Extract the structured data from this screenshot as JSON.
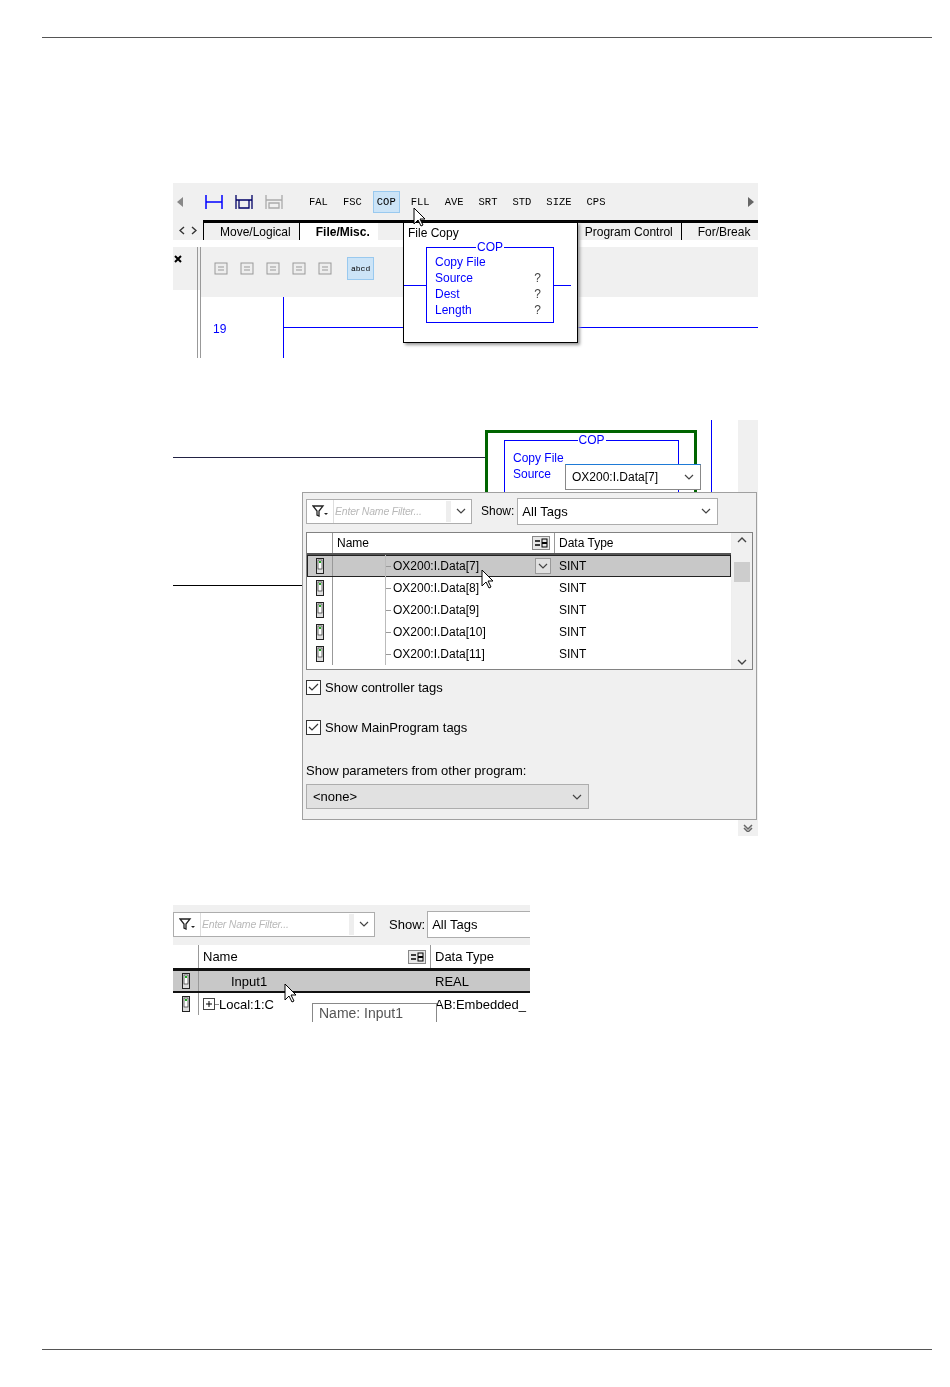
{
  "figure_1": {
    "instruction_buttons": [
      {
        "label": "FAL",
        "selected": false
      },
      {
        "label": "FSC",
        "selected": false
      },
      {
        "label": "COP",
        "selected": true
      },
      {
        "label": "FLL",
        "selected": false
      },
      {
        "label": "AVE",
        "selected": false
      },
      {
        "label": "SRT",
        "selected": false
      },
      {
        "label": "STD",
        "selected": false
      },
      {
        "label": "SIZE",
        "selected": false
      },
      {
        "label": "CPS",
        "selected": false
      }
    ],
    "category_tabs": [
      {
        "label": "Move/Logical",
        "selected": false
      },
      {
        "label": "File/Misc.",
        "selected": true
      },
      {
        "label": "Program Control",
        "selected": false
      },
      {
        "label": "For/Break",
        "selected": false
      }
    ],
    "element_buttons": [
      {
        "label": "abcd",
        "selected": true
      }
    ],
    "rung_number": "19",
    "tooltip": {
      "title": "File Copy",
      "block": {
        "mnemonic": "COP",
        "title": "Copy File",
        "operands": [
          {
            "name": "Source",
            "value": "?"
          },
          {
            "name": "Dest",
            "value": "?"
          },
          {
            "name": "Length",
            "value": "?"
          }
        ]
      }
    }
  },
  "figure_2": {
    "block": {
      "mnemonic": "COP",
      "title": "Copy File",
      "operands": [
        {
          "name": "Source"
        }
      ]
    },
    "source_field": {
      "value": "OX200:I.Data[7]"
    },
    "tag_browser": {
      "filter": {
        "placeholder": "Enter Name Filter..."
      },
      "show_label": "Show:",
      "show": {
        "value": "All Tags"
      },
      "columns": [
        "Name",
        "Data Type"
      ],
      "rows": [
        {
          "name": "OX200:I.Data[7]",
          "type": "SINT",
          "selected": true
        },
        {
          "name": "OX200:I.Data[8]",
          "type": "SINT",
          "selected": false
        },
        {
          "name": "OX200:I.Data[9]",
          "type": "SINT",
          "selected": false
        },
        {
          "name": "OX200:I.Data[10]",
          "type": "SINT",
          "selected": false
        },
        {
          "name": "OX200:I.Data[11]",
          "type": "SINT",
          "selected": false
        }
      ],
      "checkboxes": [
        {
          "label": "Show controller tags",
          "checked": true
        },
        {
          "label": "Show MainProgram tags",
          "checked": true
        }
      ],
      "other_program_label": "Show parameters from other program:",
      "other_program": {
        "value": "<none>"
      }
    }
  },
  "figure_3": {
    "filter": {
      "placeholder": "Enter Name Filter..."
    },
    "show_label": "Show:",
    "show": {
      "value": "All Tags"
    },
    "columns": [
      "Name",
      "Data Type"
    ],
    "rows": [
      {
        "name": "Input1",
        "type": "REAL",
        "selected": true,
        "expandable": false
      },
      {
        "name": "Local:1:C",
        "type": "AB:Embedded_",
        "selected": false,
        "expandable": true
      }
    ],
    "tooltip": {
      "text": "Name: Input1"
    }
  }
}
